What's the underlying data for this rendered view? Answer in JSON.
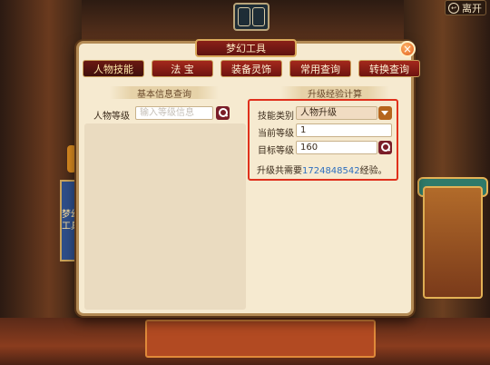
{
  "top": {
    "exit_label": "离开"
  },
  "dialog": {
    "title": "梦幻工具",
    "close": "×",
    "tabs": [
      "人物技能",
      "法 宝",
      "装备灵饰",
      "常用查询",
      "转换查询"
    ],
    "active_tab": "人物技能"
  },
  "basic_info": {
    "section_title": "基本信息查询",
    "label": "人物等级",
    "placeholder": "输入等级信息"
  },
  "exp_calc": {
    "section_title": "升级经验计算",
    "skill_type_label": "技能类别",
    "skill_type_value": "人物升级",
    "current_level_label": "当前等级",
    "current_level_value": "1",
    "target_level_label": "目标等级",
    "target_level_value": "160",
    "result_prefix": "升级共需要",
    "result_value": "1724848542",
    "result_suffix": "经验。"
  },
  "banner": {
    "text": "梦幻工具"
  },
  "colors": {
    "tab_red": "#a4281c",
    "panel": "#f6ead0",
    "highlight": "#e0301c",
    "result_blue": "#2e6fbf"
  }
}
